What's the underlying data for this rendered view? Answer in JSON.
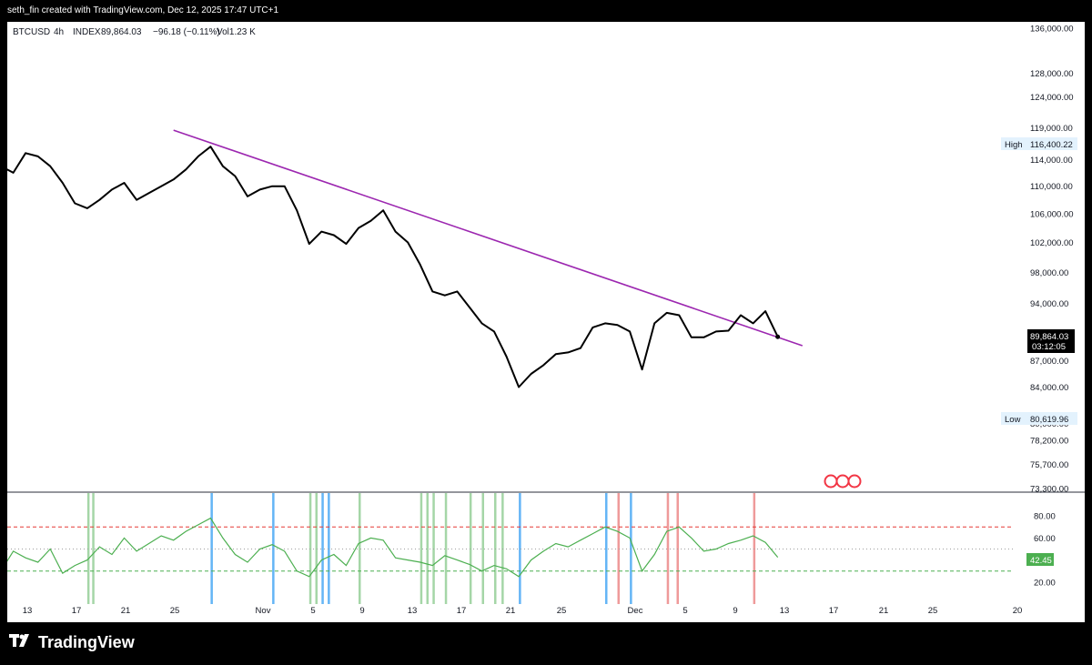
{
  "header": {
    "credit": "seth_fin created with TradingView.com, Dec 12, 2025 17:47 UTC+1"
  },
  "legend": {
    "symbol": "BTCUSD",
    "interval": "4h",
    "exchange": "INDEX",
    "last": "89,864.03",
    "change": "−96.18 (−0.11%)",
    "volume": "Vol1.23 K"
  },
  "price_axis": {
    "ticks": [
      "136,000.00",
      "128,000.00",
      "124,000.00",
      "119,000.00",
      "114,000.00",
      "110,000.00",
      "106,000.00",
      "102,000.00",
      "98,000.00",
      "94,000.00",
      "87,000.00",
      "84,000.00",
      "80,000.00",
      "78,200.00",
      "75,700.00",
      "73,300.00"
    ],
    "high_label": "High",
    "high_value": "116,400.22",
    "low_label": "Low",
    "low_value": "80,619.96",
    "last_price": "89,864.03",
    "countdown": "03:12:05"
  },
  "oscillator_axis": {
    "ticks": [
      "80.00",
      "60.00",
      "20.00"
    ],
    "current_value": "42.45"
  },
  "time_axis": {
    "labels": [
      "13",
      "17",
      "21",
      "25",
      "Nov",
      "5",
      "9",
      "13",
      "17",
      "21",
      "25",
      "Dec",
      "5",
      "9",
      "13",
      "17",
      "21",
      "25",
      "20"
    ]
  },
  "colors": {
    "price_line": "#000000",
    "trendline": "#9c27b0",
    "oscillator_line": "#4caf50",
    "oscillator_oversold": "#f23645",
    "band_lines": "#e53935",
    "buy_bars": "#a5d6a7",
    "sell_bars": "#ef9a9a",
    "blue_bars": "#64b5f6",
    "last_price_badge": "#000000",
    "rsi_badge": "#4caf50",
    "event_badge": "#f23645"
  },
  "footer": {
    "brand": "TradingView",
    "brand_icon": "tradingview-logo-icon"
  },
  "chart_data": {
    "type": "line",
    "title": "BTCUSD · 4h · INDEX",
    "x_labels": [
      "13",
      "17",
      "21",
      "25",
      "Nov",
      "5",
      "9",
      "13",
      "17",
      "21",
      "25",
      "Dec",
      "5",
      "9",
      "13"
    ],
    "series": [
      {
        "name": "BTCUSD",
        "x": [
          "Oct 10",
          "Oct 11",
          "Oct 12",
          "Oct 13",
          "Oct 14",
          "Oct 15",
          "Oct 16",
          "Oct 17",
          "Oct 18",
          "Oct 19",
          "Oct 20",
          "Oct 21",
          "Oct 22",
          "Oct 23",
          "Oct 24",
          "Oct 25",
          "Oct 26",
          "Oct 27",
          "Oct 28",
          "Oct 29",
          "Oct 30",
          "Oct 31",
          "Nov 1",
          "Nov 2",
          "Nov 3",
          "Nov 4",
          "Nov 5",
          "Nov 6",
          "Nov 7",
          "Nov 8",
          "Nov 9",
          "Nov 10",
          "Nov 11",
          "Nov 12",
          "Nov 13",
          "Nov 14",
          "Nov 15",
          "Nov 16",
          "Nov 17",
          "Nov 18",
          "Nov 19",
          "Nov 20",
          "Nov 21",
          "Nov 22",
          "Nov 23",
          "Nov 24",
          "Nov 25",
          "Nov 26",
          "Nov 27",
          "Nov 28",
          "Nov 29",
          "Nov 30",
          "Dec 1",
          "Dec 2",
          "Dec 3",
          "Dec 4",
          "Dec 5",
          "Dec 6",
          "Dec 7",
          "Dec 8",
          "Dec 9",
          "Dec 10",
          "Dec 11",
          "Dec 12"
        ],
        "values": [
          113000,
          112000,
          115000,
          114500,
          113000,
          110500,
          107500,
          106800,
          108000,
          109500,
          110500,
          108000,
          109000,
          110000,
          111000,
          112500,
          114500,
          116000,
          113000,
          111500,
          108500,
          109500,
          110000,
          110000,
          106500,
          101800,
          103500,
          103000,
          101800,
          104000,
          105000,
          106500,
          103500,
          102000,
          99000,
          95500,
          95000,
          95500,
          93500,
          91500,
          90500,
          87500,
          84000,
          85500,
          86500,
          87800,
          88000,
          88500,
          91000,
          91500,
          91300,
          90500,
          86000,
          91500,
          92800,
          92500,
          89800,
          89800,
          90500,
          90600,
          92500,
          91500,
          93000,
          89864
        ]
      },
      {
        "name": "trendline",
        "x": [
          "Oct 24",
          "Dec 14"
        ],
        "values": [
          118600,
          88800
        ]
      },
      {
        "name": "oscillator",
        "ylim": [
          0,
          100
        ],
        "x": [
          "Oct 10",
          "Oct 11",
          "Oct 12",
          "Oct 13",
          "Oct 14",
          "Oct 15",
          "Oct 16",
          "Oct 17",
          "Oct 18",
          "Oct 19",
          "Oct 20",
          "Oct 21",
          "Oct 22",
          "Oct 23",
          "Oct 24",
          "Oct 25",
          "Oct 26",
          "Oct 27",
          "Oct 28",
          "Oct 29",
          "Oct 30",
          "Oct 31",
          "Nov 1",
          "Nov 2",
          "Nov 3",
          "Nov 4",
          "Nov 5",
          "Nov 6",
          "Nov 7",
          "Nov 8",
          "Nov 9",
          "Nov 10",
          "Nov 11",
          "Nov 12",
          "Nov 13",
          "Nov 14",
          "Nov 15",
          "Nov 16",
          "Nov 17",
          "Nov 18",
          "Nov 19",
          "Nov 20",
          "Nov 21",
          "Nov 22",
          "Nov 23",
          "Nov 24",
          "Nov 25",
          "Nov 26",
          "Nov 27",
          "Nov 28",
          "Nov 29",
          "Nov 30",
          "Dec 1",
          "Dec 2",
          "Dec 3",
          "Dec 4",
          "Dec 5",
          "Dec 6",
          "Dec 7",
          "Dec 8",
          "Dec 9",
          "Dec 10",
          "Dec 11",
          "Dec 12"
        ],
        "values": [
          30,
          48,
          42,
          38,
          50,
          28,
          35,
          40,
          52,
          45,
          60,
          48,
          55,
          62,
          58,
          66,
          72,
          78,
          60,
          45,
          38,
          50,
          54,
          48,
          30,
          25,
          40,
          45,
          35,
          55,
          60,
          58,
          42,
          40,
          38,
          35,
          44,
          40,
          36,
          30,
          35,
          32,
          25,
          40,
          48,
          55,
          52,
          58,
          64,
          70,
          66,
          60,
          30,
          45,
          66,
          70,
          60,
          48,
          50,
          55,
          58,
          62,
          56,
          42.45
        ]
      }
    ],
    "price_ylim": [
      73300,
      136000
    ],
    "price_scale": "log",
    "oscillator_levels": [
      70,
      30
    ],
    "markers": {
      "high": 116400.22,
      "low": 80619.96,
      "last": 89864.03
    },
    "grid": false,
    "legend_position": "top-left"
  }
}
